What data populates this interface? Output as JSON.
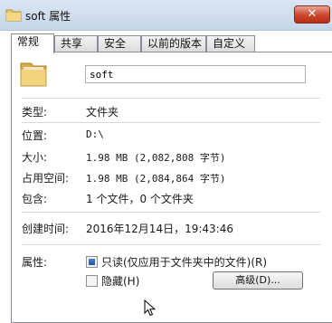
{
  "window": {
    "title": "soft 属性",
    "close_label": "✕",
    "icon": "folder-icon"
  },
  "tabs": [
    {
      "label": "常规",
      "active": true
    },
    {
      "label": "共享",
      "active": false
    },
    {
      "label": "安全",
      "active": false
    },
    {
      "label": "以前的版本",
      "active": false
    },
    {
      "label": "自定义",
      "active": false
    }
  ],
  "general": {
    "folder_name": "soft",
    "type_label": "类型:",
    "type_value": "文件夹",
    "location_label": "位置:",
    "location_value": "D:\\",
    "size_label": "大小:",
    "size_value": "1.98 MB (2,082,808 字节)",
    "disk_size_label": "占用空间:",
    "disk_size_value": "1.98 MB (2,084,864 字节)",
    "contains_label": "包含:",
    "contains_value": "1 个文件，0 个文件夹",
    "created_label": "创建时间:",
    "created_value": "2016年12月14日，19:43:46",
    "attributes_label": "属性:",
    "readonly_label": "只读(仅应用于文件夹中的文件)(R)",
    "readonly_checked": true,
    "hidden_label": "隐藏(H)",
    "hidden_checked": false,
    "advanced_button": "高级(D)..."
  },
  "colors": {
    "titlebar": "#c6d5e8",
    "close": "#c9452c",
    "folder": "#e8c46a",
    "checkbox_fill": "#2b62b8"
  }
}
